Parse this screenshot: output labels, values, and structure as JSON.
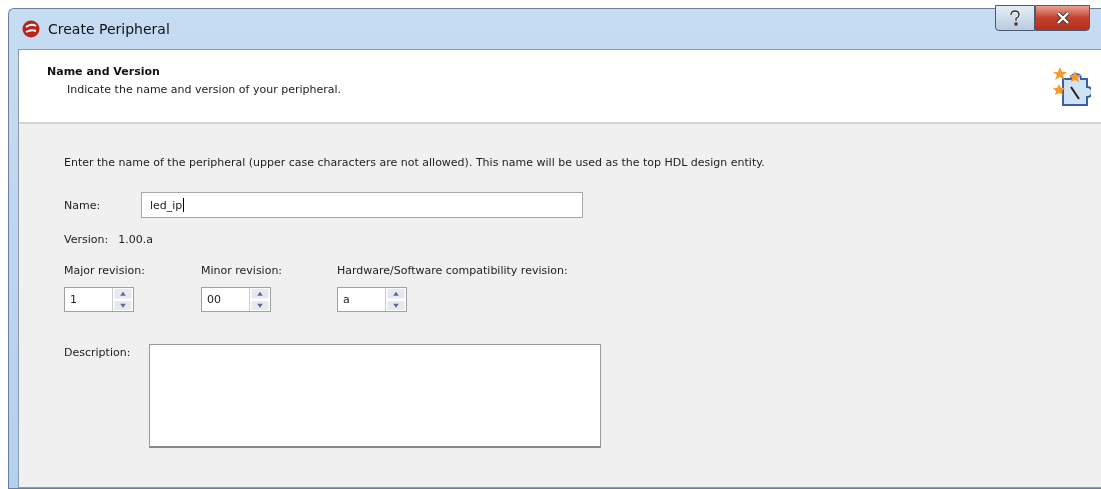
{
  "window": {
    "title": "Create Peripheral"
  },
  "header": {
    "title": "Name and Version",
    "subtitle": "Indicate the name and version of your peripheral."
  },
  "form": {
    "instruction": "Enter the name of the peripheral (upper case characters are not allowed). This name will be used as the top HDL design entity.",
    "name": {
      "label": "Name:",
      "value": "led_ip"
    },
    "version": {
      "label": "Version:",
      "value": "1.00.a"
    },
    "revisions": [
      {
        "label": "Major revision:",
        "value": "1"
      },
      {
        "label": "Minor revision:",
        "value": "00"
      },
      {
        "label": "Hardware/Software compatibility revision:",
        "value": "a"
      }
    ],
    "description": {
      "label": "Description:"
    }
  }
}
